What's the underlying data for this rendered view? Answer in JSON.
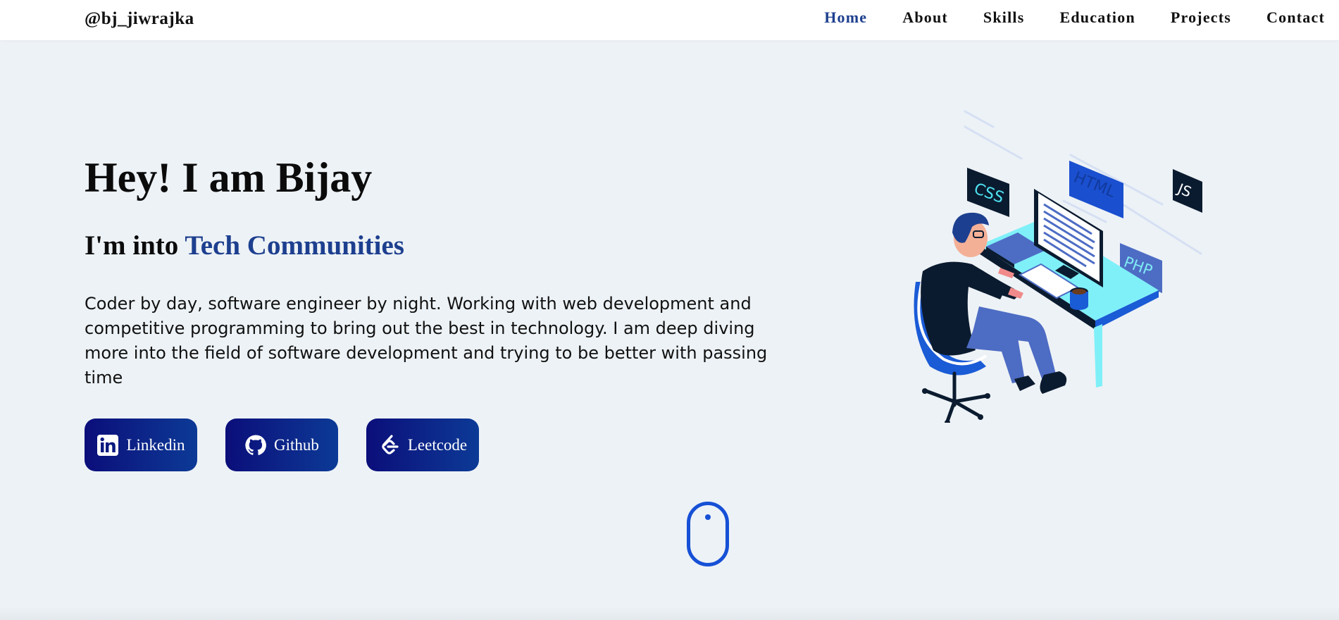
{
  "navbar": {
    "logo": "@bj_jiwrajka",
    "links": [
      {
        "label": "Home",
        "active": true
      },
      {
        "label": "About"
      },
      {
        "label": "Skills"
      },
      {
        "label": "Education"
      },
      {
        "label": "Projects"
      },
      {
        "label": "Contact"
      }
    ]
  },
  "hero": {
    "title": "Hey! I am Bijay",
    "subtitle_prefix": "I'm into",
    "subtitle_accent": "Tech Communities",
    "description": "Coder by day, software engineer by night. Working with web development and competitive programming to bring out the best in technology. I am deep diving more into the field of software development and trying to be better with passing time"
  },
  "social_buttons": [
    {
      "label": "Linkedin",
      "icon": "linkedin-icon"
    },
    {
      "label": "Github",
      "icon": "github-icon"
    },
    {
      "label": "Leetcode",
      "icon": "leetcode-icon"
    }
  ],
  "illustration": {
    "tags": [
      "CSS",
      "HTML",
      "JS",
      "PHP"
    ]
  },
  "scroll_indicator": {
    "icon": "mouse-icon"
  },
  "colors": {
    "background": "#edf2f6",
    "accent": "#1d3f8f",
    "button_gradient_start": "#0b0e7a",
    "button_gradient_end": "#0c3a96",
    "mouse": "#1650d6"
  }
}
